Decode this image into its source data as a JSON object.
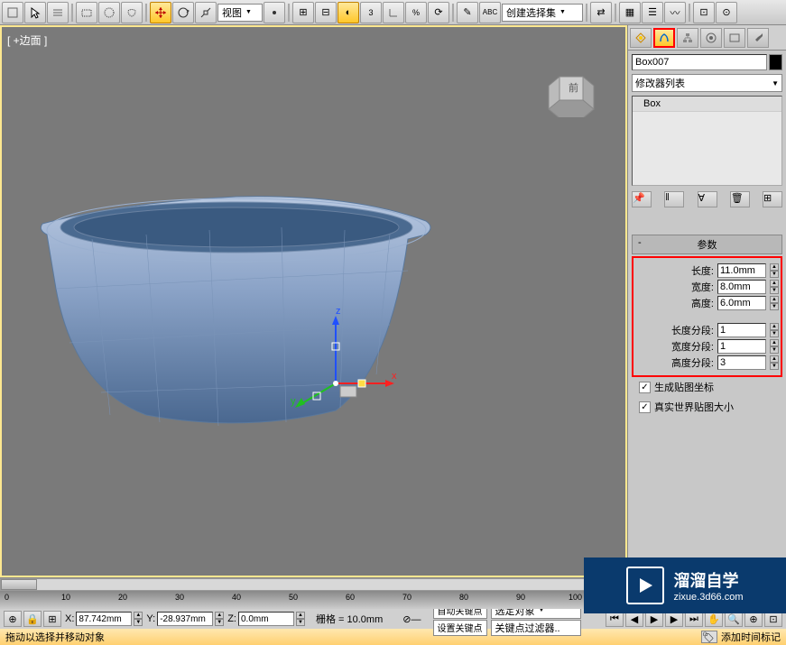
{
  "toolbar": {
    "view_dropdown": "视图",
    "selection_set": "创建选择集"
  },
  "viewport": {
    "label": "[ +边面 ]"
  },
  "panel": {
    "object_name": "Box007",
    "modifier_list": "修改器列表",
    "box_item": "Box",
    "params_title": "参数",
    "length_label": "长度:",
    "length_value": "11.0mm",
    "width_label": "宽度:",
    "width_value": "8.0mm",
    "height_label": "高度:",
    "height_value": "6.0mm",
    "length_segs_label": "长度分段:",
    "length_segs_value": "1",
    "width_segs_label": "宽度分段:",
    "width_segs_value": "1",
    "height_segs_label": "高度分段:",
    "height_segs_value": "3",
    "gen_mapping": "生成贴图坐标",
    "real_world": "真实世界贴图大小"
  },
  "ruler": {
    "marks": [
      "0",
      "10",
      "20",
      "30",
      "40",
      "50",
      "60",
      "70",
      "80",
      "90",
      "100"
    ]
  },
  "status": {
    "x_label": "X:",
    "x_value": "87.742mm",
    "y_label": "Y:",
    "y_value": "-28.937mm",
    "z_label": "Z:",
    "z_value": "0.0mm",
    "grid": "栅格 = 10.0mm",
    "auto_key": "自动关键点",
    "selected": "选定对象",
    "set_key": "设置关键点",
    "key_filter": "关键点过滤器..",
    "add_time_tag": "添加时间标记"
  },
  "prompt": "拖动以选择并移动对象",
  "watermark": {
    "cn": "溜溜自学",
    "url": "zixue.3d66.com"
  }
}
